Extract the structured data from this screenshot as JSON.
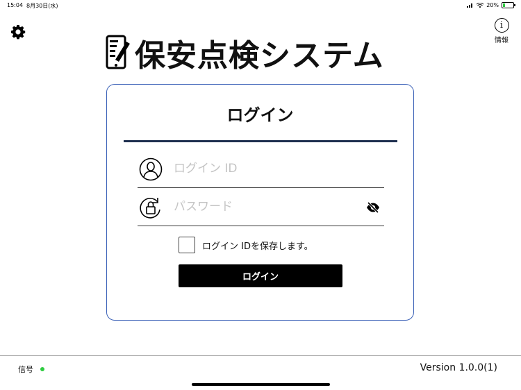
{
  "status_bar": {
    "time": "15:04",
    "date": "8月30日(水)",
    "battery": "20%"
  },
  "header": {
    "settings_icon": "gear-icon",
    "info_icon": "info-icon",
    "info_symbol": "i",
    "info_label": "情報"
  },
  "app": {
    "title": "保安点検システム",
    "title_icon": "document-edit-icon"
  },
  "login": {
    "heading": "ログイン",
    "id_placeholder": "ログイン ID",
    "id_icon": "user-icon",
    "password_placeholder": "パスワード",
    "password_icon": "lock-rotate-icon",
    "visibility_icon": "eye-off-icon",
    "remember_label": "ログイン IDを保存します。",
    "remember_checked": false,
    "button_label": "ログイン"
  },
  "footer": {
    "signal_label": "信号",
    "signal_color": "#2ecc40",
    "version": "Version 1.0.0(1)"
  },
  "colors": {
    "card_border": "#3d63b8",
    "divider": "#1e2f4f",
    "button_bg": "#000000"
  }
}
